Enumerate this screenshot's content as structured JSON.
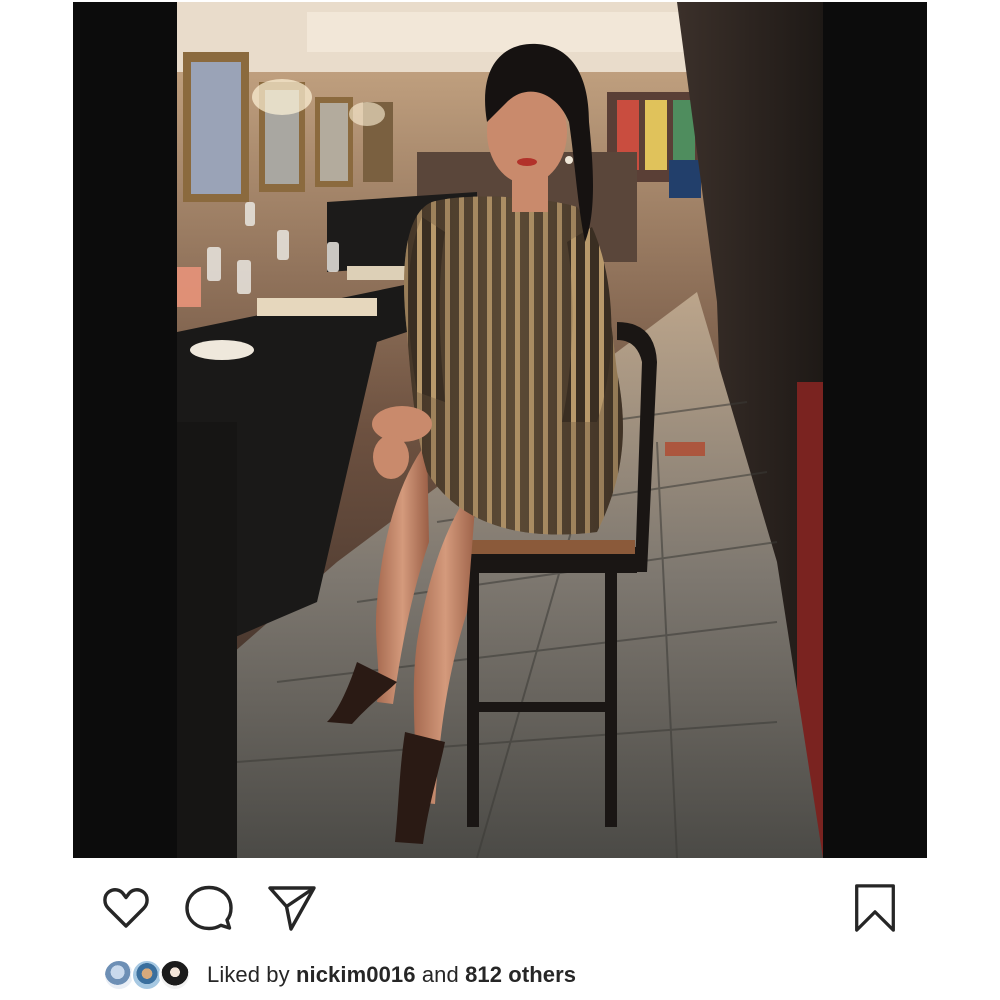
{
  "post": {
    "image": {
      "description_icon": "restaurant-photo"
    }
  },
  "actions": {
    "like_icon": "heart-outline-icon",
    "comment_icon": "comment-bubble-icon",
    "share_icon": "paper-plane-icon",
    "save_icon": "bookmark-outline-icon"
  },
  "likes": {
    "prefix": "Liked by",
    "user": "nickim0016",
    "conjunction": "and",
    "others": "812 others"
  },
  "colors": {
    "icon_stroke": "#262626",
    "background": "#ffffff",
    "photo_border": "#0c0c0c"
  }
}
